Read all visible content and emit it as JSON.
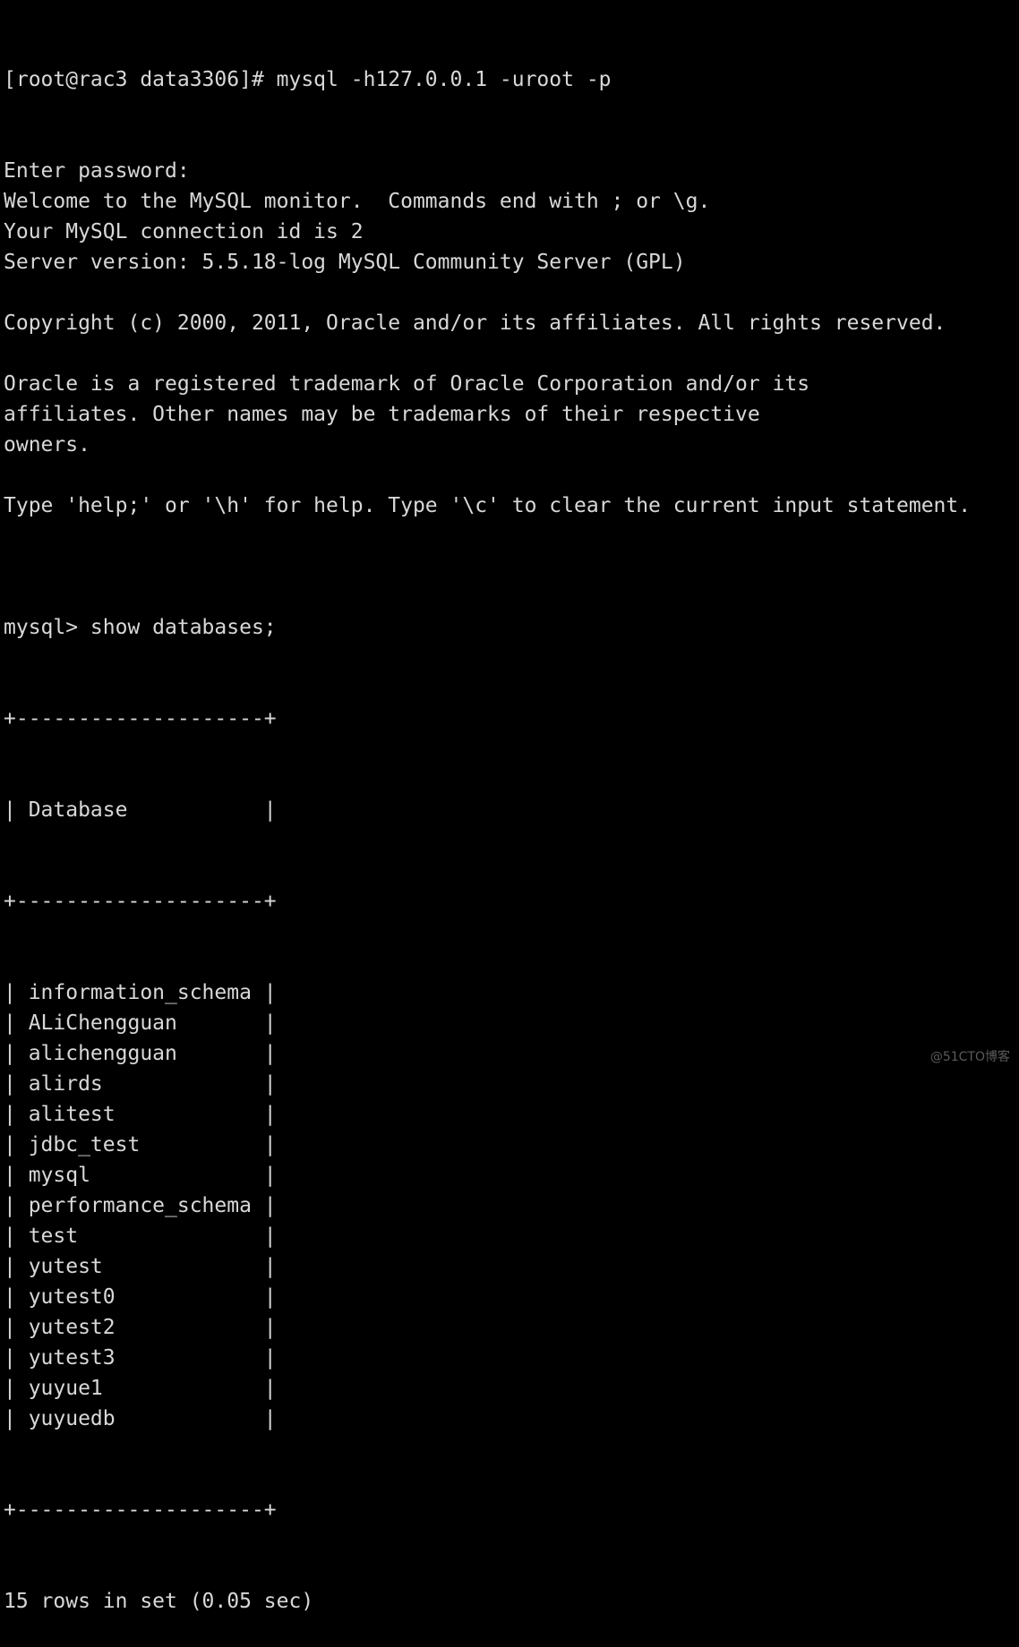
{
  "terminal": {
    "prompt_line": "[root@rac3 data3306]# mysql -h127.0.0.1 -uroot -p",
    "banner": [
      "Enter password:",
      "Welcome to the MySQL monitor.  Commands end with ; or \\g.",
      "Your MySQL connection id is 2",
      "Server version: 5.5.18-log MySQL Community Server (GPL)",
      "",
      "Copyright (c) 2000, 2011, Oracle and/or its affiliates. All rights reserved.",
      "",
      "Oracle is a registered trademark of Oracle Corporation and/or its",
      "affiliates. Other names may be trademarks of their respective",
      "owners.",
      "",
      "Type 'help;' or '\\h' for help. Type '\\c' to clear the current input statement.",
      ""
    ],
    "command": "mysql> show databases;",
    "table": {
      "border": "+--------------------+",
      "header": "| Database           |",
      "rows": [
        "| information_schema |",
        "| ALiChengguan       |",
        "| alichengguan       |",
        "| alirds             |",
        "| alitest            |",
        "| jdbc_test          |",
        "| mysql              |",
        "| performance_schema |",
        "| test               |",
        "| yutest             |",
        "| yutest0            |",
        "| yutest2            |",
        "| yutest3            |",
        "| yuyue1             |",
        "| yuyuedb            |"
      ]
    },
    "result_summary": "15 rows in set (0.05 sec)"
  },
  "watermark": "@51CTO博客"
}
